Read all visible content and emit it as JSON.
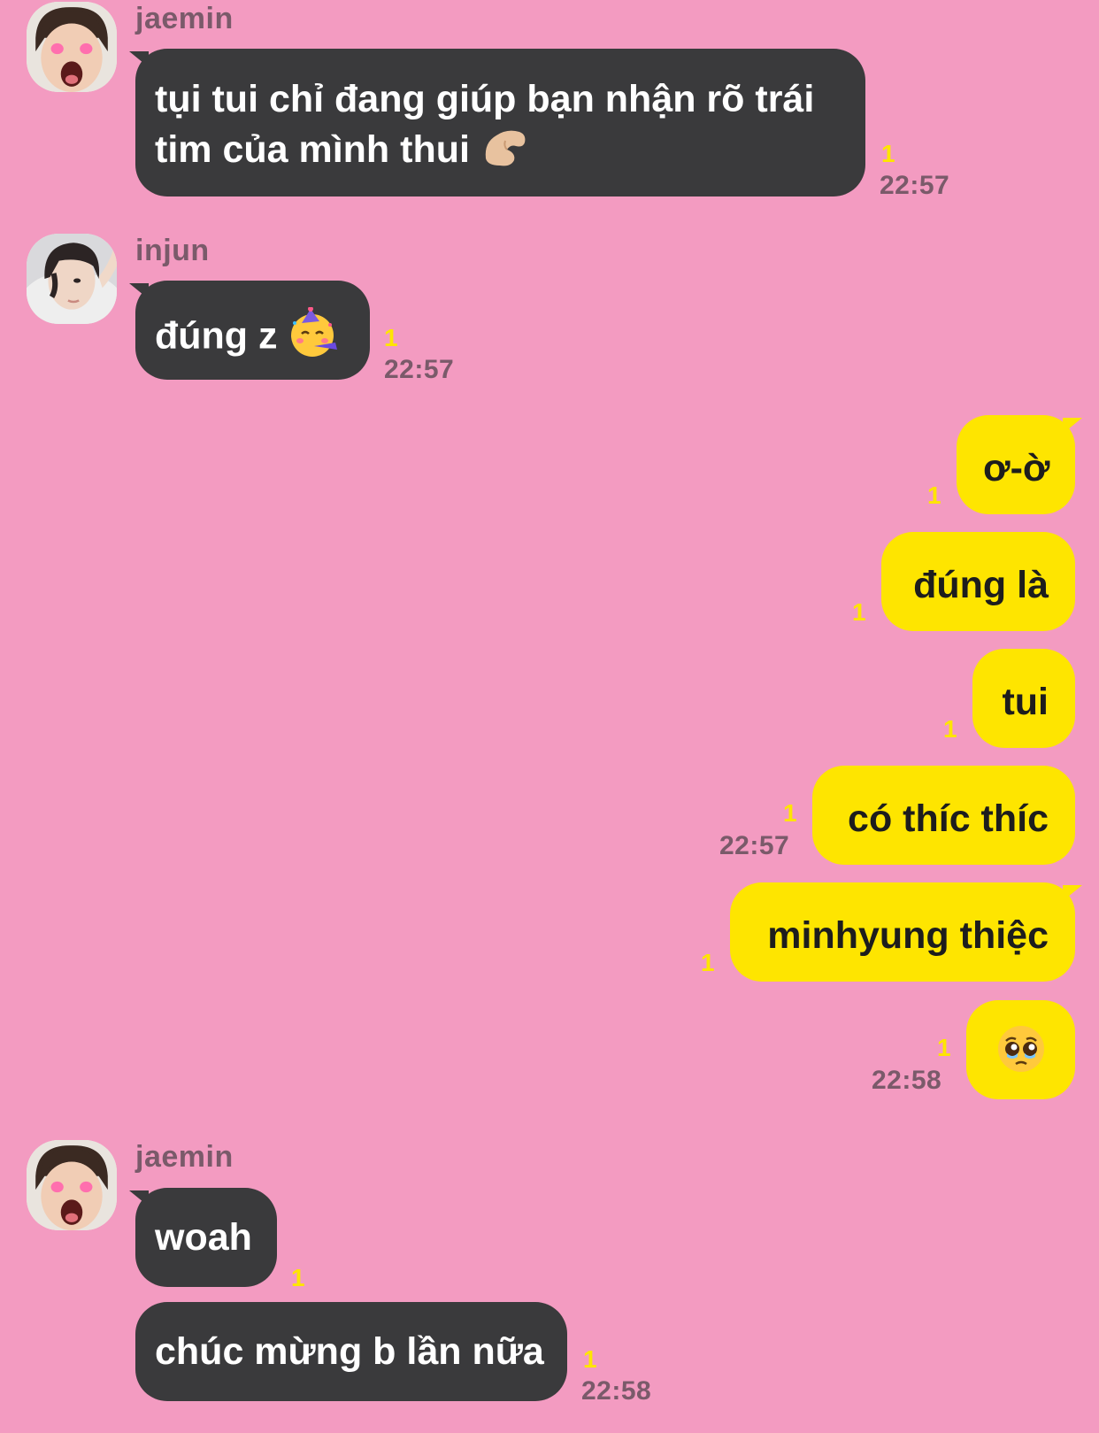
{
  "messages": {
    "m1": {
      "sender": "jaemin",
      "line1": "tụi tui chỉ đang giúp bạn nhận rõ trái",
      "line2": "tim của mình thui",
      "unread": "1",
      "time": "22:57"
    },
    "m2": {
      "sender": "injun",
      "text": "đúng z",
      "unread": "1",
      "time": "22:57"
    },
    "o1": {
      "text": "ơ-ờ",
      "unread": "1"
    },
    "o2": {
      "text": "đúng là",
      "unread": "1"
    },
    "o3": {
      "text": "tui",
      "unread": "1"
    },
    "o4": {
      "text": "có thíc thíc",
      "unread": "1",
      "time": "22:57"
    },
    "o5": {
      "text": "minhyung thiệc",
      "unread": "1"
    },
    "o6": {
      "unread": "1",
      "time": "22:58"
    },
    "m3": {
      "sender": "jaemin",
      "text": "woah",
      "unread": "1"
    },
    "m4": {
      "text": "chúc mừng b lần nữa",
      "unread": "1",
      "time": "22:58"
    }
  },
  "icons": {
    "m1_emoji": "pinching-hand-icon",
    "m2_emoji": "partying-face-icon",
    "o6_emoji": "pleading-face-icon"
  }
}
